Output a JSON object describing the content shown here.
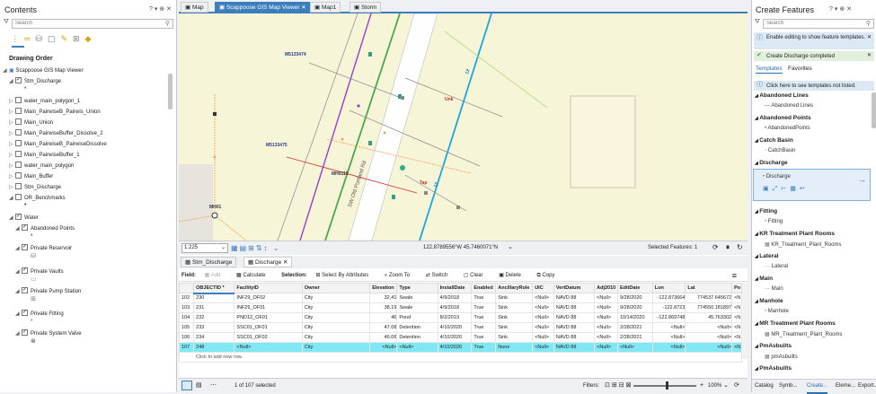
{
  "contents": {
    "title": "Contents",
    "controls": "? ▾ ⊕ ✕",
    "search_placeholder": "Search",
    "drawing_order": "Drawing Order",
    "layers": [
      {
        "label": "Scappoose GIS Map Viewer",
        "indent": 0,
        "arrow": "◢",
        "checked": false,
        "nocb": true
      },
      {
        "label": "Stm_Discharge",
        "indent": 1,
        "arrow": "◢",
        "checked": true
      },
      {
        "label": "water_main_polygon_1",
        "indent": 1,
        "arrow": "▷",
        "checked": false
      },
      {
        "label": "Main_PairwiseB_Pairwis_Union",
        "indent": 1,
        "arrow": "▷",
        "checked": false
      },
      {
        "label": "Main_Union",
        "indent": 1,
        "arrow": "▷",
        "checked": false
      },
      {
        "label": "Main_PairwiseBuffer_Dissolve_2",
        "indent": 1,
        "arrow": "▷",
        "checked": false
      },
      {
        "label": "Main_PairwiseB_PairwiseDissolve",
        "indent": 1,
        "arrow": "▷",
        "checked": false
      },
      {
        "label": "Main_PairwiseBuffer_1",
        "indent": 1,
        "arrow": "▷",
        "checked": false
      },
      {
        "label": "water_main_polygon",
        "indent": 1,
        "arrow": "▷",
        "checked": false
      },
      {
        "label": "Main_Buffer",
        "indent": 1,
        "arrow": "▷",
        "checked": false
      },
      {
        "label": "Stm_Discharge",
        "indent": 1,
        "arrow": "▷",
        "checked": false
      },
      {
        "label": "OR_Benchmarks",
        "indent": 1,
        "arrow": "◢",
        "checked": false
      },
      {
        "label": "Water",
        "indent": 1,
        "arrow": "◢",
        "checked": true
      },
      {
        "label": "Abandoned Points",
        "indent": 2,
        "arrow": "◢",
        "checked": true
      },
      {
        "label": "Private Reservoir",
        "indent": 2,
        "arrow": "◢",
        "checked": true
      },
      {
        "label": "Private Vaults",
        "indent": 2,
        "arrow": "◢",
        "checked": true
      },
      {
        "label": "Private Pump Station",
        "indent": 2,
        "arrow": "◢",
        "checked": true
      },
      {
        "label": "Private Fitting",
        "indent": 2,
        "arrow": "◢",
        "checked": true
      },
      {
        "label": "Private System Valve",
        "indent": 2,
        "arrow": "◢",
        "checked": true
      }
    ]
  },
  "tabs": [
    {
      "label": "Map",
      "active": false
    },
    {
      "label": "Scappoose GIS Map Viewer",
      "active": true
    },
    {
      "label": "Map1",
      "active": false
    },
    {
      "label": "Storm",
      "active": false
    }
  ],
  "map": {
    "labels": [
      "M5133474",
      "M5133475",
      "MH0115",
      "MH01",
      "Unk",
      "Tap",
      "12",
      "12",
      "SW Old Portland Rd"
    ]
  },
  "status": {
    "scale": "1:225",
    "coords": "122.8789556°W 45.7460071°N",
    "selected": "Selected Features: 1"
  },
  "attr_tabs": [
    "Stm_Discharge",
    "Discharge"
  ],
  "attr_toolbar": {
    "field": "Field:",
    "add": "Add",
    "calculate": "Calculate",
    "selection": "Selection:",
    "select_by_attr": "Select By Attributes",
    "zoom_to": "Zoom To",
    "switch": "Switch",
    "clear": "Clear",
    "delete": "Delete",
    "copy": "Copy"
  },
  "table": {
    "headers": [
      "",
      "OBJECTID *",
      "FacilityID",
      "Owner",
      "Elevation",
      "Type",
      "InstallDate",
      "Enabled",
      "AncillaryRole",
      "UIC",
      "VertDatum",
      "Adj2010",
      "EditDate",
      "Lon",
      "Lat",
      "Po"
    ],
    "rows": [
      [
        "102",
        "230",
        "INF29_OF02",
        "City",
        "32.41",
        "Swale",
        "4/9/2018",
        "True",
        "Sink",
        "<Null>",
        "NAVD 88",
        "<Null>",
        "9/28/2020",
        "-122.873664",
        "774537.645672",
        "<N"
      ],
      [
        "103",
        "231",
        "INF29_OF01",
        "City",
        "38.19",
        "Swale",
        "4/9/2018",
        "True",
        "Sink",
        "<Null>",
        "NAVD 88",
        "<Null>",
        "9/28/2020",
        "-122.8723",
        "774550.181897",
        "<N"
      ],
      [
        "104",
        "232",
        "PND12_OF01",
        "City",
        "46",
        "Pond",
        "8/2/2019",
        "True",
        "Sink",
        "<Null>",
        "NAVD 88",
        "<Null>",
        "10/14/2020",
        "-122.869748",
        "45.763302",
        "<N"
      ],
      [
        "105",
        "233",
        "SSC01_OF01",
        "City",
        "47.08",
        "Detention",
        "4/10/2020",
        "True",
        "Sink",
        "<Null>",
        "NAVD 88",
        "<Null>",
        "2/28/2021",
        "<Null>",
        "<Null>",
        "<N"
      ],
      [
        "106",
        "234",
        "SSC01_OF02",
        "City",
        "46.06",
        "Detention",
        "4/10/2020",
        "True",
        "Sink",
        "<Null>",
        "NAVD 88",
        "<Null>",
        "2/28/2021",
        "<Null>",
        "<Null>",
        "<N"
      ],
      [
        "107",
        "248",
        "<Null>",
        "City",
        "<Null>",
        "<Null>",
        "4/10/2020",
        "True",
        "None",
        "<Null>",
        "NAVD 88",
        "<Null>",
        "<Null>",
        "<Null>",
        "<Null>",
        "<N"
      ]
    ],
    "add_row": "Click to add new row."
  },
  "bottom": {
    "selected": "1 of 107 selected",
    "filters": "Filters:",
    "zoom": "100%"
  },
  "create": {
    "title": "Create Features",
    "controls": "? ▾ ⊕ ✕",
    "search_placeholder": "Search",
    "msg1": "Enable editing to show feature templates.",
    "msg2": "Create Discharge completed",
    "tab_templates": "Templates",
    "tab_favorites": "Favorites",
    "msg3": "Click here to see templates not listed.",
    "groups": [
      {
        "name": "Abandoned Lines",
        "item": "Abandoned Lines"
      },
      {
        "name": "Abandoned Points",
        "item": "AbandonedPoints"
      },
      {
        "name": "Catch Basin",
        "item": "CatchBasin"
      },
      {
        "name": "Discharge",
        "item": "Discharge"
      },
      {
        "name": "Fitting",
        "item": "Fitting"
      },
      {
        "name": "KR Treatment Plant Rooms",
        "item": "KR_Treatment_Plant_Rooms"
      },
      {
        "name": "Lateral",
        "item": "Lateral"
      },
      {
        "name": "Main",
        "item": "Main"
      },
      {
        "name": "Manhole",
        "item": "Manhole"
      },
      {
        "name": "MR Treatment Plant Rooms",
        "item": "MR_Treatment_Plant_Rooms"
      },
      {
        "name": "PmAsbuilts",
        "item": "pmAsbuilts"
      },
      {
        "name": "PmAsbuilts",
        "item": ""
      }
    ],
    "bottom_tabs": [
      "Catalog",
      "Symb...",
      "Create...",
      "Eleme...",
      "Export..."
    ]
  }
}
